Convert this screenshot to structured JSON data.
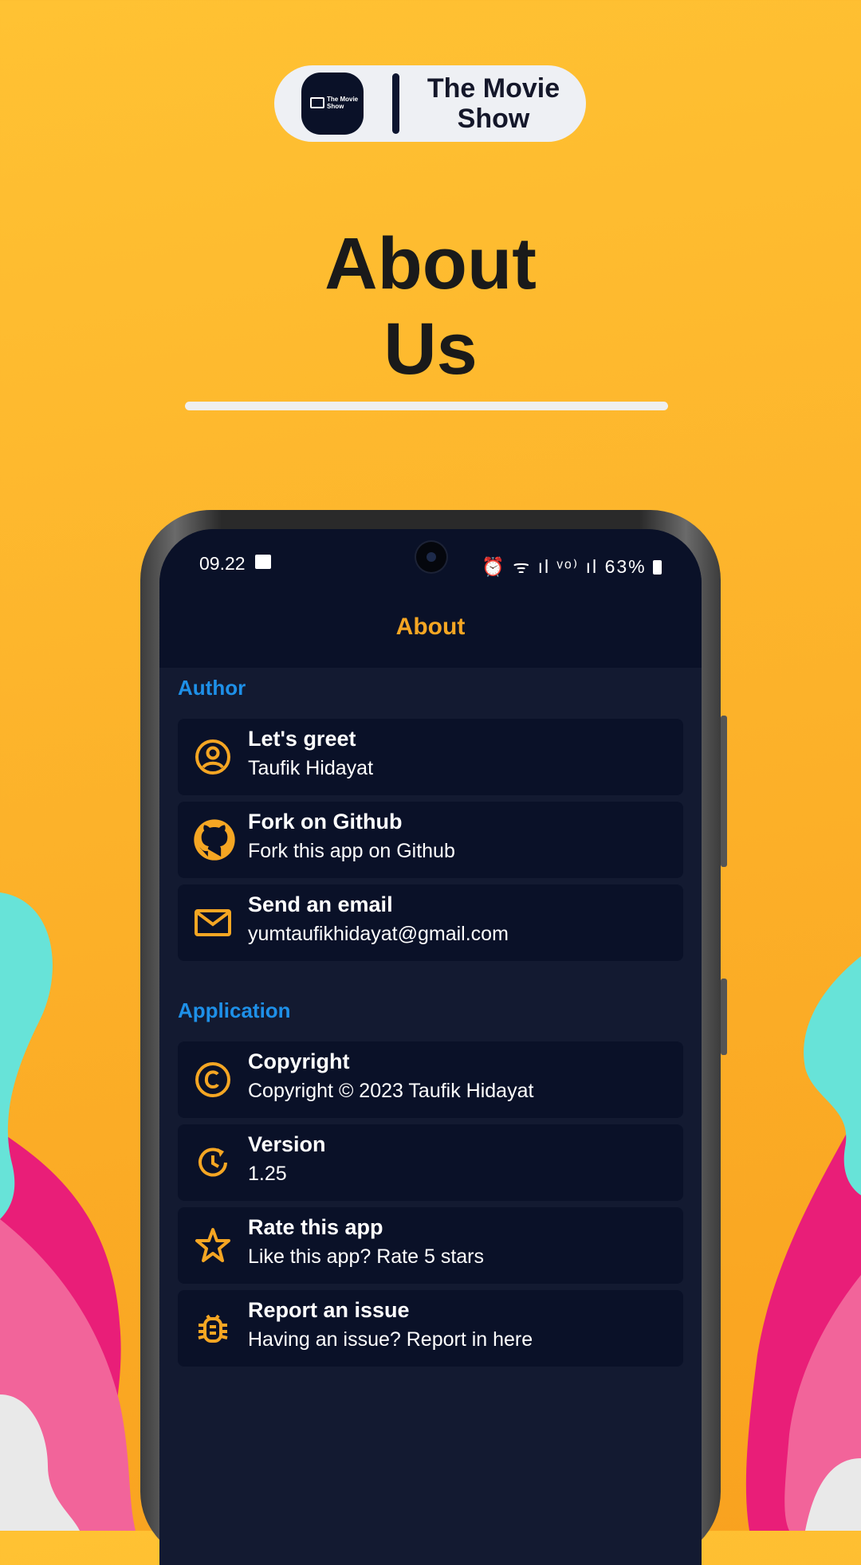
{
  "colors": {
    "background": "#fdb52c",
    "accent": "#f5a623",
    "section_header": "#1e90e8",
    "screen_bg": "#131a31",
    "card_bg": "#0a1128"
  },
  "brand": {
    "logo_text": "The Movie Show",
    "name": "The Movie Show"
  },
  "hero": {
    "title_line1": "About",
    "title_line2": "Us"
  },
  "status_bar": {
    "time": "09.22",
    "icons": "⏰ ᯤ ıl ᵛᵒ⁾ ıl",
    "battery": "63%"
  },
  "app_bar": {
    "title": "About"
  },
  "sections": {
    "author": {
      "header": "Author",
      "items": [
        {
          "title": "Let's greet",
          "subtitle": "Taufik Hidayat",
          "icon": "user-circle-icon"
        },
        {
          "title": "Fork on Github",
          "subtitle": "Fork this app on Github",
          "icon": "github-icon"
        },
        {
          "title": "Send an email",
          "subtitle": "yumtaufikhidayat@gmail.com",
          "icon": "mail-icon"
        }
      ]
    },
    "application": {
      "header": "Application",
      "items": [
        {
          "title": "Copyright",
          "subtitle": "Copyright © 2023 Taufik Hidayat",
          "icon": "copyright-icon"
        },
        {
          "title": "Version",
          "subtitle": "1.25",
          "icon": "update-clock-icon"
        },
        {
          "title": "Rate this app",
          "subtitle": "Like this app? Rate 5 stars",
          "icon": "star-icon"
        },
        {
          "title": "Report an issue",
          "subtitle": "Having an issue? Report in here",
          "icon": "bug-icon"
        }
      ]
    }
  }
}
